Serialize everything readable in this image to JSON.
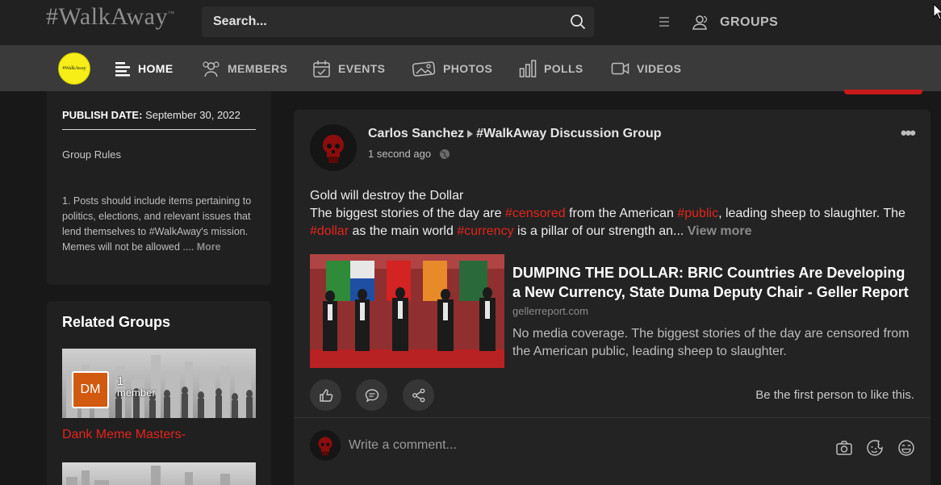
{
  "header": {
    "logo": "#WalkAway",
    "logo_tm": "™",
    "search_placeholder": "Search...",
    "groups_label": "GROUPS"
  },
  "nav": {
    "badge_text": "#WalkAway",
    "items": [
      {
        "label": "HOME",
        "icon": "home-lines-icon",
        "active": true
      },
      {
        "label": "MEMBERS",
        "icon": "members-icon"
      },
      {
        "label": "EVENTS",
        "icon": "calendar-icon"
      },
      {
        "label": "PHOTOS",
        "icon": "photos-icon"
      },
      {
        "label": "POLLS",
        "icon": "polls-icon"
      },
      {
        "label": "VIDEOS",
        "icon": "video-icon"
      }
    ]
  },
  "sidebar": {
    "publish_label": "PUBLISH DATE:",
    "publish_date": "September 30, 2022",
    "rules_title": "Group Rules",
    "rules_text": "1. Posts should include items pertaining to politics, elections, and relevant issues that lend themselves to #WalkAway's mission. Memes will not be allowed ....",
    "rules_more": "More",
    "related_title": "Related Groups",
    "related": [
      {
        "initials": "DM",
        "member_count": "1",
        "member_label": "member",
        "name": "Dank Meme Masters-"
      }
    ]
  },
  "post": {
    "author": "Carlos Sanchez",
    "group": "#WalkAway Discussion Group",
    "time": "1 second ago",
    "line1": "Gold will destroy the Dollar",
    "body_parts": [
      {
        "t": "The biggest stories of the day are ",
        "tag": false
      },
      {
        "t": "#censored",
        "tag": true
      },
      {
        "t": " from the American ",
        "tag": false
      },
      {
        "t": "#public",
        "tag": true
      },
      {
        "t": ", leading sheep to slaughter. The ",
        "tag": false
      },
      {
        "t": "#dollar",
        "tag": true
      },
      {
        "t": " as the main world ",
        "tag": false
      },
      {
        "t": "#currency",
        "tag": true
      },
      {
        "t": " is a pillar of our strength an...",
        "tag": false
      }
    ],
    "view_more": "View more",
    "link_title": "DUMPING THE DOLLAR: BRIC Countries Are Developing a New Currency, State Duma Deputy Chair - Geller Report",
    "link_domain": "gellerreport.com",
    "link_desc": "No media coverage. The biggest stories of the day are censored from the American public, leading sheep to slaughter.",
    "first_like": "Be the first person to like this.",
    "comment_placeholder": "Write a comment..."
  },
  "colors": {
    "accent_red": "#e3241c",
    "badge_yellow": "#f6ee16",
    "group_orange": "#d15a10"
  }
}
